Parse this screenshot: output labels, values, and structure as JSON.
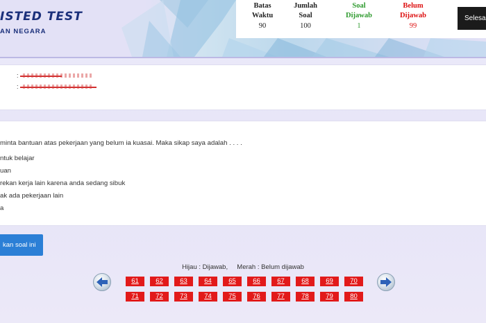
{
  "header": {
    "logo_line1": "ISTED TEST",
    "logo_line2": "AN NEGARA",
    "stats": {
      "batas_label1": "Batas",
      "batas_label2": "Waktu",
      "batas_value": "90",
      "jumlah_label1": "Jumlah",
      "jumlah_label2": "Soal",
      "jumlah_value": "100",
      "dijawab_label1": "Soal",
      "dijawab_label2": "Dijawab",
      "dijawab_value": "1",
      "belum_label1": "Belum",
      "belum_label2": "Dijawab",
      "belum_value": "99"
    },
    "finish_label": "Selesa",
    "colors": {
      "answered": "#2e9a2e",
      "unanswered": "#dd1111"
    }
  },
  "participant": {
    "name_prefix": ":",
    "email_prefix": ":"
  },
  "question": {
    "text": "minta bantuan atas pekerjaan yang belum ia kuasai. Maka sikap saya adalah . . . .",
    "options": [
      "ntuk belajar",
      "uan",
      " rekan kerja lain karena anda sedang sibuk",
      "ak ada pekerjaan lain",
      "a"
    ]
  },
  "ask_button": "kan soal ini",
  "legend": "Hijau : Dijawab,     Merah : Belum dijawab",
  "nav": {
    "prev_icon": "arrow-left-icon",
    "next_icon": "arrow-right-icon"
  },
  "question_numbers": [
    "61",
    "62",
    "63",
    "64",
    "65",
    "66",
    "67",
    "68",
    "69",
    "70",
    "71",
    "72",
    "73",
    "74",
    "75",
    "76",
    "77",
    "78",
    "79",
    "80"
  ]
}
